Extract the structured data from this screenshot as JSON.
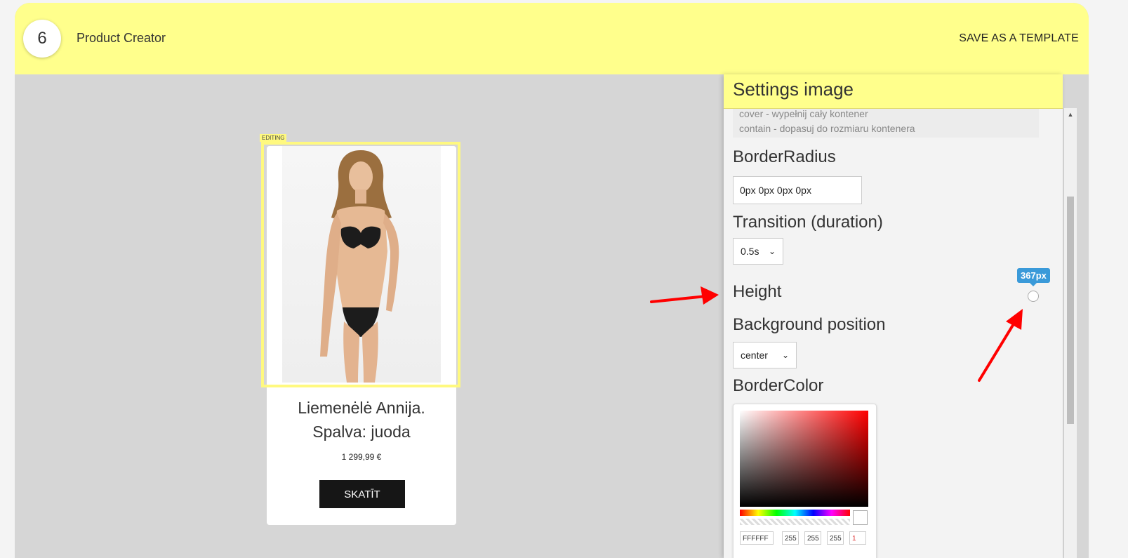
{
  "header": {
    "step_number": "6",
    "title": "Product Creator",
    "save_template_label": "SAVE AS A TEMPLATE"
  },
  "canvas": {
    "editing_tag": "EDITING",
    "product": {
      "name_line1": "Liemenėlė Annija.",
      "name_line2": "Spalva: juoda",
      "price": "1 299,99 €",
      "buy_label": "SKATĪT"
    }
  },
  "panel": {
    "title": "Settings image",
    "hint_lines": [
      "cover - wypełnij cały kontener",
      "contain - dopasuj do rozmiaru kontenera"
    ],
    "border_radius": {
      "label": "BorderRadius",
      "value": "0px 0px 0px 0px"
    },
    "transition": {
      "label": "Transition (duration)",
      "value": "0.5s"
    },
    "height": {
      "label": "Height",
      "value": "367px"
    },
    "background_position": {
      "label": "Background position",
      "value": "center"
    },
    "border_color": {
      "label": "BorderColor",
      "hex": "FFFFFF",
      "r": "255",
      "g": "255",
      "b": "255",
      "a": "1"
    }
  },
  "colors": {
    "header_yellow": "#ffff8c",
    "editing_yellow": "#fff97f",
    "button_dark": "#161616",
    "tooltip_blue": "#3a9ad9",
    "arrow_red": "#ff0000"
  },
  "icons": {
    "select_chevron": "chevron-down-icon",
    "scroll_up": "triangle-up-icon"
  }
}
